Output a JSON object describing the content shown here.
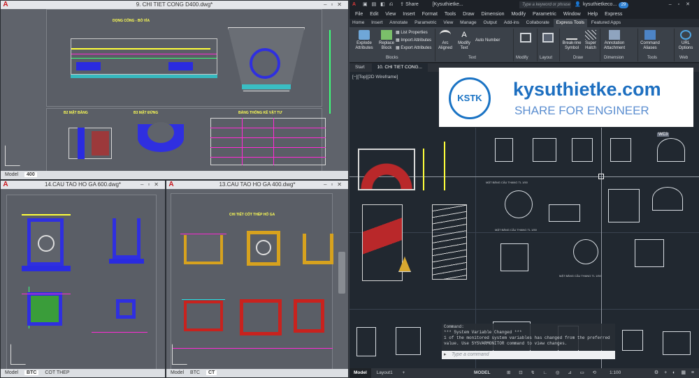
{
  "top_left_window": {
    "title": "9. CHI TIET CONG D400.dwg*",
    "tabs": [
      "Model",
      "400"
    ],
    "active_tab": "400",
    "drawing_labels": {
      "section_top": "DỌNG CỐNG - BÓ VỈA",
      "plan_1": "B2 MẶT BẰNG",
      "section_2": "B3 MẶT ĐỨNG",
      "table_title": "BẢNG THỐNG KÊ VẬT TƯ"
    }
  },
  "bottom_left_window": {
    "title": "14.CAU TAO HO GA 600.dwg*",
    "tabs": [
      "Model",
      "BTC",
      "COT THEP"
    ],
    "active_tab": "BTC"
  },
  "bottom_mid_window": {
    "title": "13.CAU TAO HO GA 400.dwg*",
    "tabs": [
      "Model",
      "BTC",
      "CT"
    ],
    "active_tab": "CT",
    "drawing_labels": {
      "header": "CHI TIẾT CỐT THÉP HỐ GA"
    }
  },
  "app": {
    "qat_share": "Share",
    "doc_title": "[Kysuthietke...",
    "search_placeholder": "Type a keyword or phrase",
    "user": "kysuthietkeco...",
    "notif_count": "29",
    "menus": [
      "File",
      "Edit",
      "View",
      "Insert",
      "Format",
      "Tools",
      "Draw",
      "Dimension",
      "Modify",
      "Parametric",
      "Window",
      "Help",
      "Express"
    ],
    "ribbon_tabs": [
      "Home",
      "Insert",
      "Annotate",
      "Parametric",
      "View",
      "Manage",
      "Output",
      "Add-ins",
      "Collaborate",
      "Express Tools",
      "Featured Apps"
    ],
    "active_ribbon_tab": "Express Tools",
    "ribbon": {
      "explode_attributes": "Explode Attributes",
      "replace_block": "Replace Block",
      "list_properties": "List Properties",
      "import_attributes": "Import Attributes",
      "export_attributes": "Export Attributes",
      "arc_aligned": "Arc Aligned",
      "modify_text": "Modify Text",
      "auto_number": "Auto Number",
      "breakline_symbol": "Break-line Symbol",
      "super_hatch": "Super Hatch",
      "annotation_attachment": "Annotation Attachment",
      "command_aliases": "Command Aliases",
      "url_options": "URL Options",
      "panels": {
        "blocks": "Blocks",
        "text": "Text",
        "modify": "Modify",
        "layout": "Layout",
        "draw": "Draw",
        "dimension": "Dimension",
        "tools": "Tools",
        "web": "Web"
      }
    },
    "doc_tabs": [
      "Start",
      "10. CHI TIET CONG..."
    ],
    "viewport_label": "[−][Top][2D Wireframe]",
    "brand": {
      "name": "kysuthietke.com",
      "tagline": "SHARE FOR ENGINEER",
      "logo_text": "KSTK"
    },
    "drawing_labels": {
      "plan_1": "MẶT BẰNG CẦU THANG TL 1/50",
      "plan_2": "MẶT BẰNG CẦU THANG TL 1/50",
      "plan_3": "MẶT BẰNG CẦU THANG TL 1/50",
      "badge": "WC3"
    },
    "command": {
      "header": "Command:",
      "line1": "*** System Variable Changed ***",
      "line2": "1 of the monitored system variables has changed from the preferred",
      "line3": "value. Use SYSVARMONITOR command to view changes.",
      "input_placeholder": "Type a command"
    },
    "status_tabs": [
      "Model",
      "Layout1"
    ],
    "active_status_tab": "Model",
    "model_label": "MODEL",
    "scale": "1:100"
  }
}
